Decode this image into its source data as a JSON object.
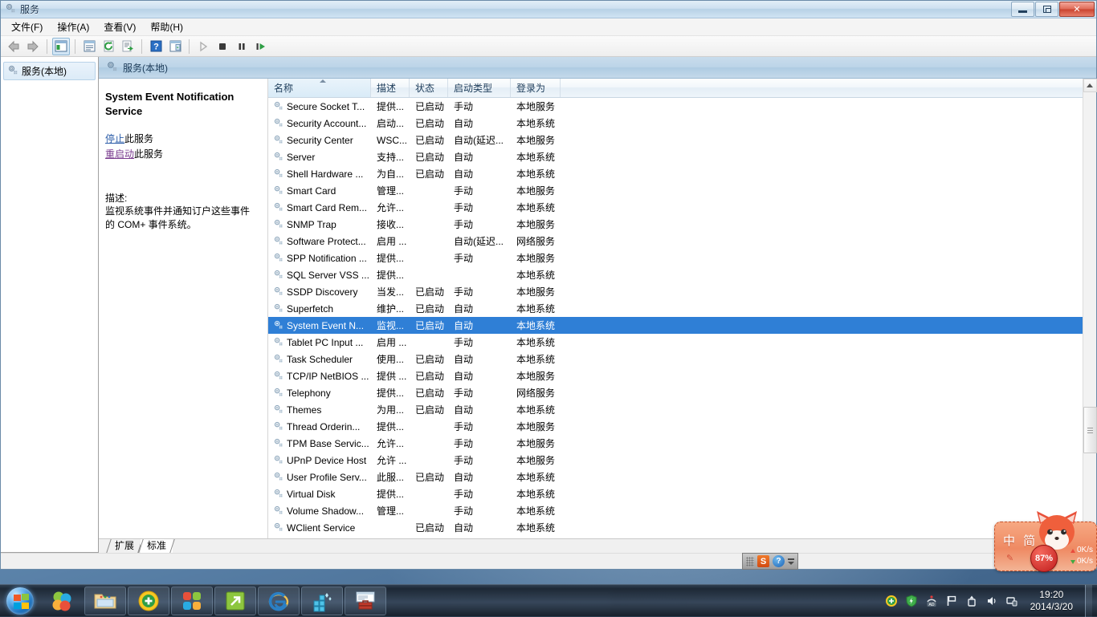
{
  "window": {
    "title": "服务",
    "title_icon": "services-gear-icon",
    "controls": {
      "minimize": "最小化",
      "restore": "还原",
      "close": "关闭"
    }
  },
  "menubar": [
    {
      "label": "文件(F)",
      "name": "menu-file"
    },
    {
      "label": "操作(A)",
      "name": "menu-action"
    },
    {
      "label": "查看(V)",
      "name": "menu-view"
    },
    {
      "label": "帮助(H)",
      "name": "menu-help"
    }
  ],
  "toolbar": [
    {
      "name": "back-button",
      "icon": "back-arrow-icon",
      "enabled": true
    },
    {
      "name": "forward-button",
      "icon": "forward-arrow-icon",
      "enabled": true
    },
    {
      "name": "show-hide-tree-button",
      "icon": "tree-panel-icon",
      "enabled": true
    },
    {
      "name": "properties-button",
      "icon": "properties-icon",
      "enabled": true
    },
    {
      "name": "refresh-button",
      "icon": "refresh-icon",
      "enabled": true
    },
    {
      "name": "export-list-button",
      "icon": "export-icon",
      "enabled": true
    },
    {
      "name": "help-button",
      "icon": "help-question-icon",
      "enabled": true
    },
    {
      "name": "show-action-pane-button",
      "icon": "action-pane-icon",
      "enabled": true
    },
    {
      "name": "start-service-button",
      "icon": "play-icon",
      "enabled": false
    },
    {
      "name": "stop-service-button",
      "icon": "stop-icon",
      "enabled": true
    },
    {
      "name": "pause-service-button",
      "icon": "pause-icon",
      "enabled": true
    },
    {
      "name": "restart-service-button",
      "icon": "restart-icon",
      "enabled": true
    }
  ],
  "tree": {
    "items": [
      {
        "label": "服务(本地)",
        "icon": "services-gear-icon",
        "selected": true
      }
    ]
  },
  "result_header": {
    "label": "服务(本地)",
    "icon": "services-gear-icon"
  },
  "details": {
    "service_title": "System Event Notification Service",
    "links": [
      {
        "link_text": "停止",
        "suffix": "此服务",
        "style": "blue",
        "name": "stop-service-link"
      },
      {
        "link_text": "重启动",
        "suffix": "此服务",
        "style": "purple",
        "name": "restart-service-link"
      }
    ],
    "description_label": "描述:",
    "description_text": "监视系统事件并通知订户这些事件的 COM+ 事件系统。"
  },
  "list": {
    "columns": [
      {
        "label": "名称",
        "key": "name",
        "sorted": true,
        "sort_dir": "asc"
      },
      {
        "label": "描述",
        "key": "desc",
        "sorted": false
      },
      {
        "label": "状态",
        "key": "state",
        "sorted": false
      },
      {
        "label": "启动类型",
        "key": "startup",
        "sorted": false
      },
      {
        "label": "登录为",
        "key": "logon",
        "sorted": false
      }
    ],
    "rows": [
      {
        "name": "Secure Socket T...",
        "desc": "提供...",
        "state": "已启动",
        "startup": "手动",
        "logon": "本地服务",
        "selected": false
      },
      {
        "name": "Security Account...",
        "desc": "启动...",
        "state": "已启动",
        "startup": "自动",
        "logon": "本地系统",
        "selected": false
      },
      {
        "name": "Security Center",
        "desc": "WSC...",
        "state": "已启动",
        "startup": "自动(延迟...",
        "logon": "本地服务",
        "selected": false
      },
      {
        "name": "Server",
        "desc": "支持...",
        "state": "已启动",
        "startup": "自动",
        "logon": "本地系统",
        "selected": false
      },
      {
        "name": "Shell Hardware ...",
        "desc": "为自...",
        "state": "已启动",
        "startup": "自动",
        "logon": "本地系统",
        "selected": false
      },
      {
        "name": "Smart Card",
        "desc": "管理...",
        "state": "",
        "startup": "手动",
        "logon": "本地服务",
        "selected": false
      },
      {
        "name": "Smart Card Rem...",
        "desc": "允许...",
        "state": "",
        "startup": "手动",
        "logon": "本地系统",
        "selected": false
      },
      {
        "name": "SNMP Trap",
        "desc": "接收...",
        "state": "",
        "startup": "手动",
        "logon": "本地服务",
        "selected": false
      },
      {
        "name": "Software Protect...",
        "desc": "启用 ...",
        "state": "",
        "startup": "自动(延迟...",
        "logon": "网络服务",
        "selected": false
      },
      {
        "name": "SPP Notification ...",
        "desc": "提供...",
        "state": "",
        "startup": "手动",
        "logon": "本地服务",
        "selected": false
      },
      {
        "name": "SQL Server VSS ...",
        "desc": "提供...",
        "state": "",
        "startup": "",
        "logon": "本地系统",
        "selected": false
      },
      {
        "name": "SSDP Discovery",
        "desc": "当发...",
        "state": "已启动",
        "startup": "手动",
        "logon": "本地服务",
        "selected": false
      },
      {
        "name": "Superfetch",
        "desc": "维护...",
        "state": "已启动",
        "startup": "自动",
        "logon": "本地系统",
        "selected": false
      },
      {
        "name": "System Event N...",
        "desc": "监视...",
        "state": "已启动",
        "startup": "自动",
        "logon": "本地系统",
        "selected": true
      },
      {
        "name": "Tablet PC Input ...",
        "desc": "启用 ...",
        "state": "",
        "startup": "手动",
        "logon": "本地系统",
        "selected": false
      },
      {
        "name": "Task Scheduler",
        "desc": "使用...",
        "state": "已启动",
        "startup": "自动",
        "logon": "本地系统",
        "selected": false
      },
      {
        "name": "TCP/IP NetBIOS ...",
        "desc": "提供 ...",
        "state": "已启动",
        "startup": "自动",
        "logon": "本地服务",
        "selected": false
      },
      {
        "name": "Telephony",
        "desc": "提供...",
        "state": "已启动",
        "startup": "手动",
        "logon": "网络服务",
        "selected": false
      },
      {
        "name": "Themes",
        "desc": "为用...",
        "state": "已启动",
        "startup": "自动",
        "logon": "本地系统",
        "selected": false
      },
      {
        "name": "Thread Orderin...",
        "desc": "提供...",
        "state": "",
        "startup": "手动",
        "logon": "本地服务",
        "selected": false
      },
      {
        "name": "TPM Base Servic...",
        "desc": "允许...",
        "state": "",
        "startup": "手动",
        "logon": "本地服务",
        "selected": false
      },
      {
        "name": "UPnP Device Host",
        "desc": "允许 ...",
        "state": "",
        "startup": "手动",
        "logon": "本地服务",
        "selected": false
      },
      {
        "name": "User Profile Serv...",
        "desc": "此服...",
        "state": "已启动",
        "startup": "自动",
        "logon": "本地系统",
        "selected": false
      },
      {
        "name": "Virtual Disk",
        "desc": "提供...",
        "state": "",
        "startup": "手动",
        "logon": "本地系统",
        "selected": false
      },
      {
        "name": "Volume Shadow...",
        "desc": "管理...",
        "state": "",
        "startup": "手动",
        "logon": "本地系统",
        "selected": false
      },
      {
        "name": "WClient Service",
        "desc": "",
        "state": "已启动",
        "startup": "自动",
        "logon": "本地系统",
        "selected": false
      }
    ]
  },
  "tabs": [
    {
      "label": "扩展",
      "active": false,
      "name": "tab-extended"
    },
    {
      "label": "标准",
      "active": true,
      "name": "tab-standard"
    }
  ],
  "ime_status": {
    "logo": "S",
    "help": "?"
  },
  "sogou": {
    "mode_text": "中 简",
    "cpu_percent": "87%",
    "upload_speed": "0K/s",
    "download_speed": "0K/s"
  },
  "taskbar": {
    "start_button": "start-orb",
    "items": [
      {
        "name": "taskbar-item-quicklaunch",
        "icon": "colored-circles-icon"
      },
      {
        "name": "taskbar-item-explorer",
        "icon": "folder-icon"
      },
      {
        "name": "taskbar-item-antivirus",
        "icon": "green-shield-plus-icon"
      },
      {
        "name": "taskbar-item-apps",
        "icon": "four-squares-icon"
      },
      {
        "name": "taskbar-item-shortcut",
        "icon": "green-arrow-icon"
      },
      {
        "name": "taskbar-item-ie",
        "icon": "internet-explorer-icon"
      },
      {
        "name": "taskbar-item-defrag",
        "icon": "blue-cubes-icon"
      },
      {
        "name": "taskbar-item-toolbox",
        "icon": "red-toolbox-icon"
      }
    ],
    "tray": [
      {
        "name": "tray-icon-antivirus",
        "icon": "green-circle-plus-icon"
      },
      {
        "name": "tray-icon-security",
        "icon": "green-shield-icon"
      },
      {
        "name": "tray-icon-network-radio",
        "icon": "wireless-ad-icon"
      },
      {
        "name": "tray-icon-action-center",
        "icon": "flag-icon"
      },
      {
        "name": "tray-icon-safely-remove",
        "icon": "usb-eject-icon"
      },
      {
        "name": "tray-icon-volume",
        "icon": "speaker-icon"
      },
      {
        "name": "tray-icon-network",
        "icon": "monitor-network-icon"
      }
    ],
    "clock": {
      "time": "19:20",
      "date": "2014/3/20"
    }
  }
}
